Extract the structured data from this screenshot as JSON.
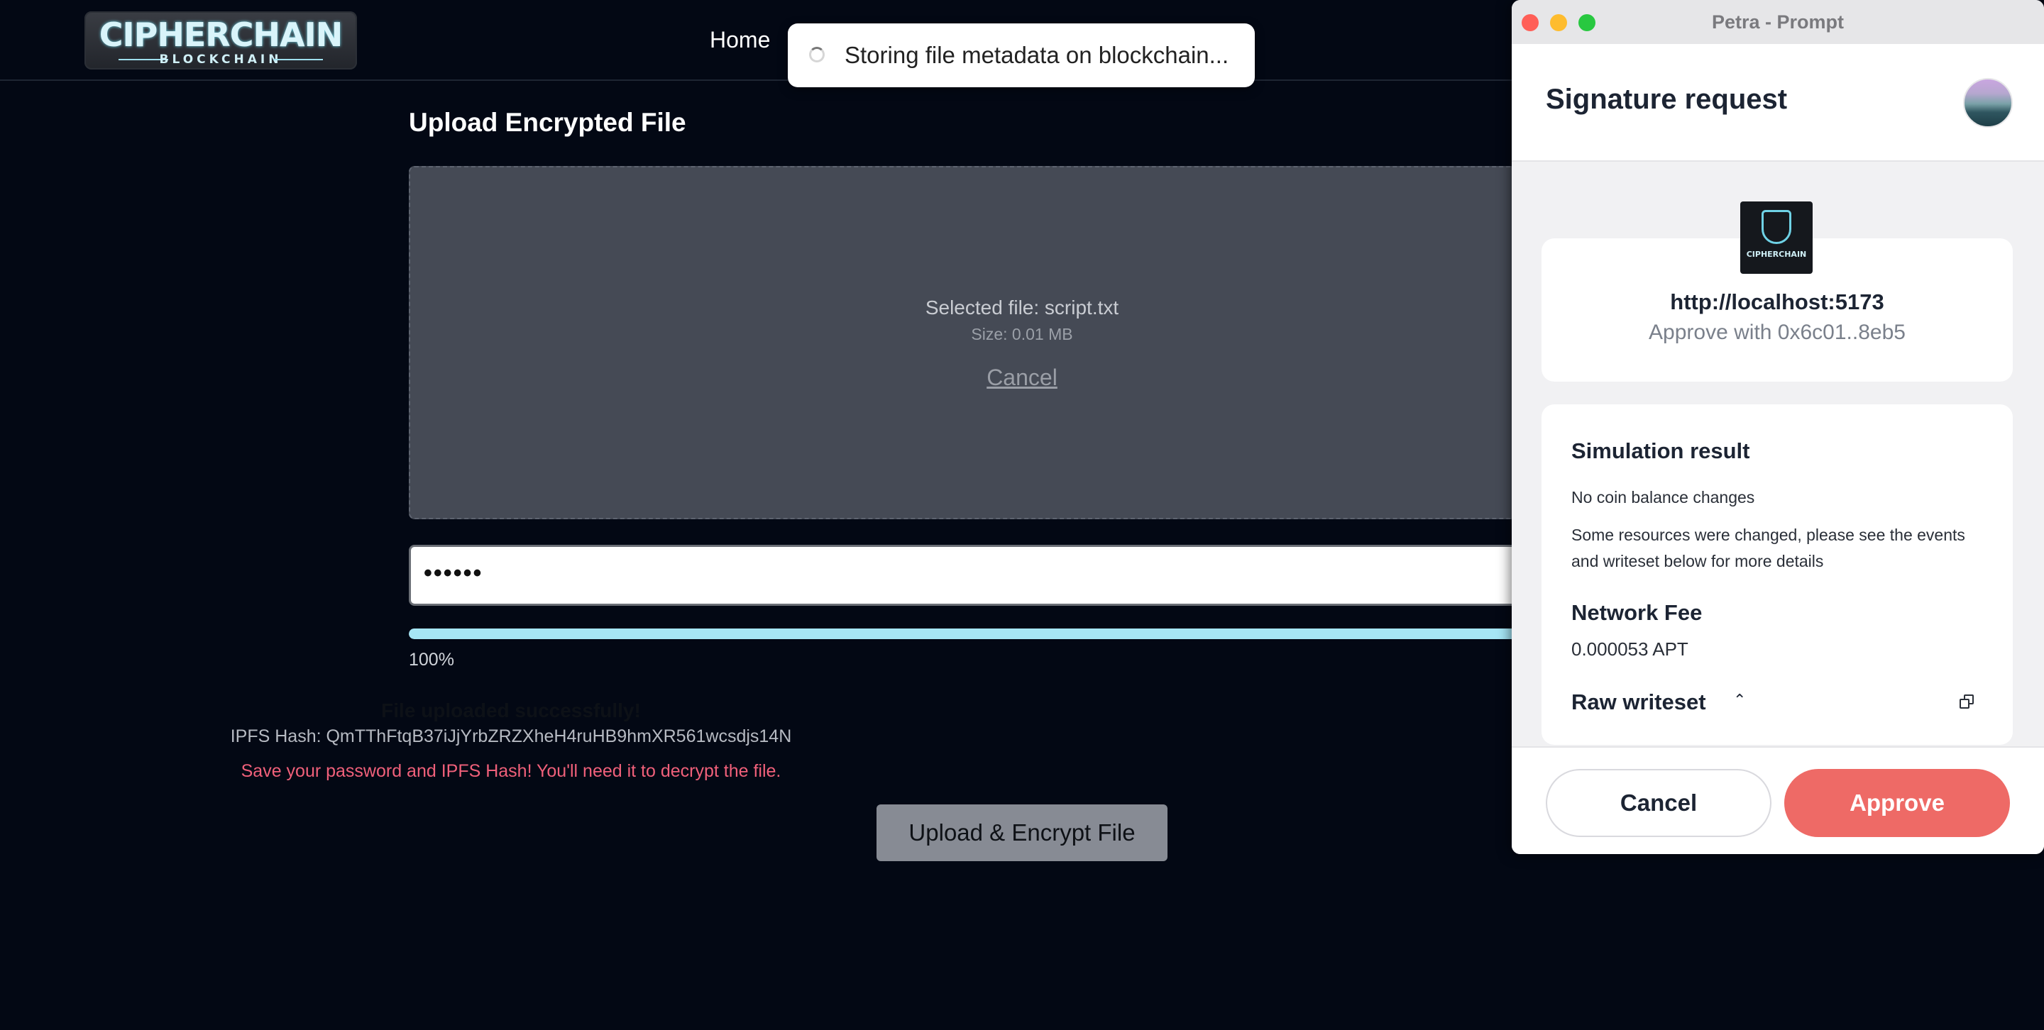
{
  "app": {
    "logo": {
      "title": "CIPHERCHAIN",
      "subtitle": "BLOCKCHAIN"
    },
    "nav": {
      "home": "Home"
    },
    "toast": {
      "message": "Storing file metadata on blockchain..."
    },
    "upload": {
      "title": "Upload Encrypted File",
      "selected_file": "Selected file: script.txt",
      "size": "Size: 0.01 MB",
      "cancel": "Cancel",
      "password_mask": "••••••",
      "progress_label": "100%",
      "progress_value": 1.0,
      "success": "File uploaded successfully!",
      "ipfs_hash": "IPFS Hash: QmTThFtqB37iJjYrbZRZXheH4ruHB9hmXR561wcsdjs14N",
      "warning": "Save your password and IPFS Hash! You'll need it to decrypt the file.",
      "button": "Upload & Encrypt File"
    }
  },
  "petra": {
    "window_title": "Petra - Prompt",
    "header": {
      "title": "Signature request"
    },
    "origin": {
      "url": "http://localhost:5173",
      "approve_with": "Approve with 0x6c01..8eb5",
      "icon_caption": "CIPHERCHAIN"
    },
    "simulation": {
      "title": "Simulation result",
      "line1": "No coin balance changes",
      "line2": "Some resources were changed, please see the events and writeset below for more details"
    },
    "network_fee": {
      "title": "Network Fee",
      "value": "0.000053 APT"
    },
    "raw_writeset": {
      "title": "Raw writeset"
    },
    "buttons": {
      "cancel": "Cancel",
      "approve": "Approve"
    }
  },
  "colors": {
    "accent": "#a6e6f5",
    "approve": "#ee6a66",
    "warning": "#f0607a"
  }
}
